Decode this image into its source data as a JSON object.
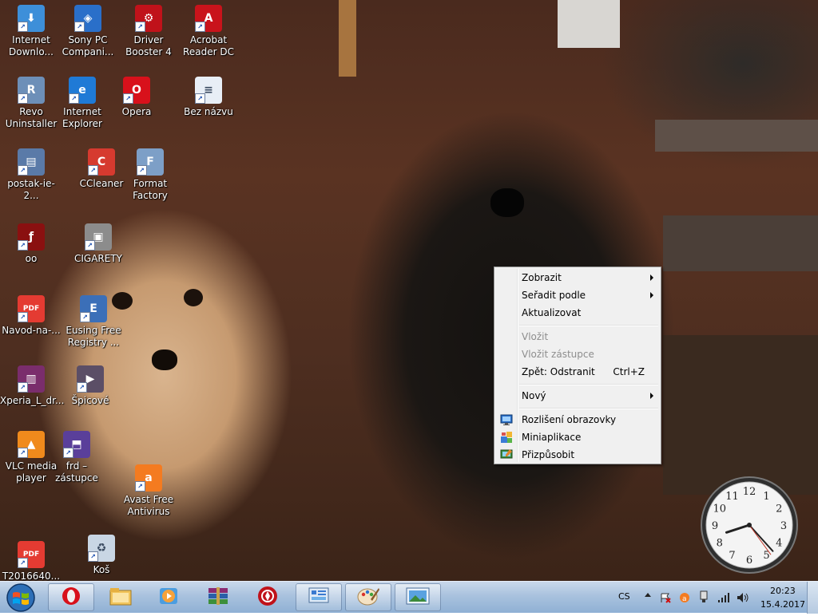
{
  "desktop": {
    "icons": [
      {
        "label": "Internet Downlo...",
        "icon": "internet-download-manager-icon"
      },
      {
        "label": "Sony PC Compani...",
        "icon": "sony-pc-companion-icon"
      },
      {
        "label": "Driver Booster 4",
        "icon": "driver-booster-icon"
      },
      {
        "label": "Acrobat Reader DC",
        "icon": "acrobat-reader-icon"
      },
      {
        "label": "Revo Uninstaller",
        "icon": "revo-uninstaller-icon"
      },
      {
        "label": "Internet Explorer",
        "icon": "internet-explorer-icon"
      },
      {
        "label": "Opera",
        "icon": "opera-icon"
      },
      {
        "label": "Bez názvu",
        "icon": "document-icon"
      },
      {
        "label": "postak-ie-2...",
        "icon": "archive-icon"
      },
      {
        "label": "CCleaner",
        "icon": "ccleaner-icon"
      },
      {
        "label": "Format Factory",
        "icon": "format-factory-icon"
      },
      {
        "label": "oo",
        "icon": "flash-icon"
      },
      {
        "label": "CIGARETY",
        "icon": "image-icon"
      },
      {
        "label": "Navod-na-...",
        "icon": "pdf-icon"
      },
      {
        "label": "Eusing Free Registry ...",
        "icon": "registry-cleaner-icon"
      },
      {
        "label": "Xperia_L_dr...",
        "icon": "winrar-icon"
      },
      {
        "label": "Špicové",
        "icon": "video-icon"
      },
      {
        "label": "VLC media player",
        "icon": "vlc-icon"
      },
      {
        "label": "frd – zástupce",
        "icon": "shortcut-icon"
      },
      {
        "label": "Avast Free Antivirus",
        "icon": "avast-icon"
      },
      {
        "label": "T2016640...",
        "icon": "pdf-icon"
      },
      {
        "label": "Koš",
        "icon": "recycle-bin-icon"
      }
    ]
  },
  "context_menu": {
    "items": [
      {
        "label": "Zobrazit",
        "submenu": true
      },
      {
        "label": "Seřadit podle",
        "submenu": true
      },
      {
        "label": "Aktualizovat"
      },
      {
        "label": "Vložit",
        "disabled": true
      },
      {
        "label": "Vložit zástupce",
        "disabled": true
      },
      {
        "label": "Zpět: Odstranit",
        "shortcut": "Ctrl+Z"
      },
      {
        "label": "Nový",
        "submenu": true
      },
      {
        "label": "Rozlišení obrazovky",
        "icon": "screen-resolution-icon"
      },
      {
        "label": "Miniaplikace",
        "icon": "gadgets-icon"
      },
      {
        "label": "Přizpůsobit",
        "icon": "personalize-icon"
      }
    ]
  },
  "clock": {
    "numbers": [
      "12",
      "1",
      "2",
      "3",
      "4",
      "5",
      "6",
      "7",
      "8",
      "9",
      "10",
      "11"
    ],
    "hour": 8.4,
    "minute": 23,
    "second": 24
  },
  "taskbar": {
    "items": [
      {
        "icon": "opera-icon"
      },
      {
        "icon": "file-explorer-icon"
      },
      {
        "icon": "media-player-icon"
      },
      {
        "icon": "winrar-icon"
      },
      {
        "icon": "driver-booster-icon"
      },
      {
        "icon": "control-panel-icon"
      },
      {
        "icon": "paint-icon"
      },
      {
        "icon": "photo-viewer-icon"
      }
    ],
    "language": "CS",
    "time": "20:23",
    "date": "15.4.2017"
  },
  "colors": {
    "menu_bg": "#f0f0f0",
    "taskbar": "#a9c2de",
    "icon_label": "#ffffff"
  }
}
